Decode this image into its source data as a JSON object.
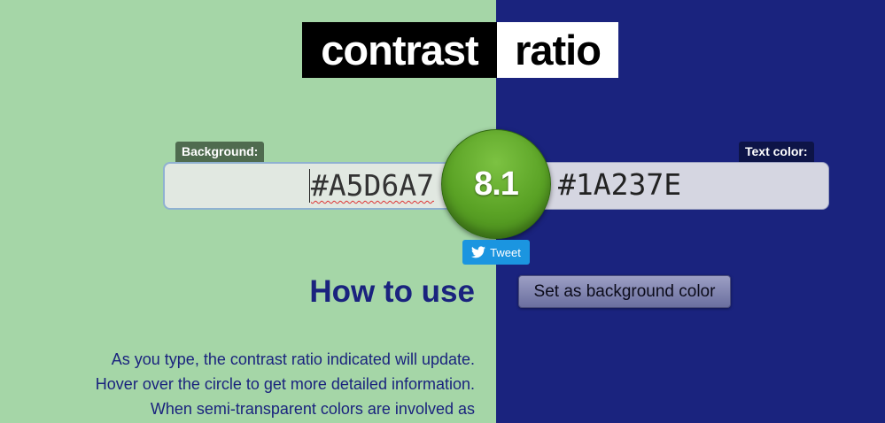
{
  "title": {
    "part1": "contrast",
    "part2": "ratio"
  },
  "background": {
    "label": "Background:",
    "value": "#A5D6A7"
  },
  "text_color": {
    "label": "Text color:",
    "value": "#1A237E"
  },
  "ratio": {
    "value": "8.1"
  },
  "tweet": {
    "label": "Tweet",
    "icon": "twitter-bird-icon"
  },
  "swap_button": {
    "label": "Set as background color"
  },
  "how_to": {
    "heading": "How to use",
    "lines": [
      "As you type, the contrast ratio indicated will update.",
      "Hover over the circle to get more detailed information.",
      "When semi-transparent colors are involved as"
    ]
  },
  "colors": {
    "left_bg": "#A5D6A7",
    "right_bg": "#1A237E",
    "circle": "#5aa225",
    "tweet": "#1b95e0"
  }
}
